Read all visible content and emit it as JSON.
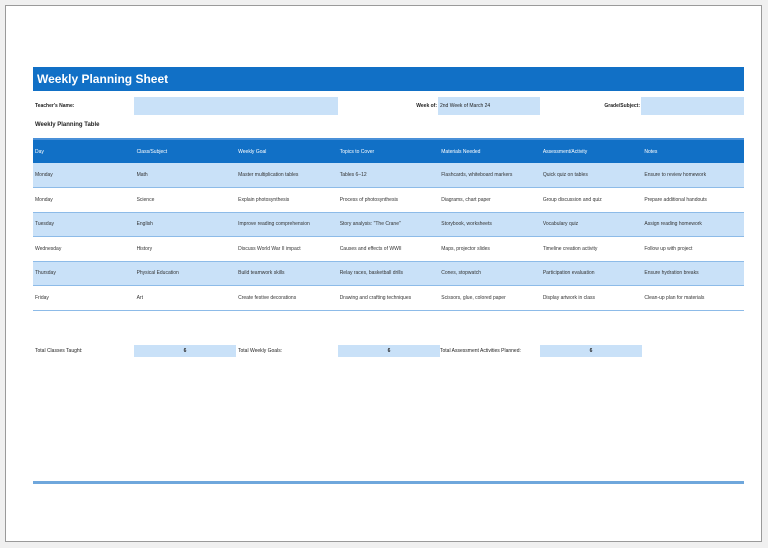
{
  "title": "Weekly Planning Sheet",
  "info": {
    "teacher_label": "Teacher's Name:",
    "teacher_value": "",
    "week_label": "Week of:",
    "week_value": "2nd Week of March 24",
    "grade_label": "Grade/Subject:",
    "grade_value": ""
  },
  "table_title": "Weekly Planning Table",
  "columns": [
    "Day",
    "Class/Subject",
    "Weekly Goal",
    "Topics to Cover",
    "Materials Needed",
    "Assessment/Activity",
    "Notes"
  ],
  "rows": [
    [
      "Monday",
      "Math",
      "Master multiplication tables",
      "Tables 6–12",
      "Flashcards, whiteboard markers",
      "Quick quiz on tables",
      "Ensure to review homework"
    ],
    [
      "Monday",
      "Science",
      "Explain photosynthesis",
      "Process of photosynthesis",
      "Diagrams, chart paper",
      "Group discussion and quiz",
      "Prepare additional handouts"
    ],
    [
      "Tuesday",
      "English",
      "Improve reading comprehension",
      "Story analysis: \"The Crane\"",
      "Storybook, worksheets",
      "Vocabulary quiz",
      "Assign reading homework"
    ],
    [
      "Wednesday",
      "History",
      "Discuss World War II impact",
      "Causes and effects of WWII",
      "Maps, projector slides",
      "Timeline creation activity",
      "Follow up with project"
    ],
    [
      "Thursday",
      "Physical Education",
      "Build teamwork skills",
      "Relay races, basketball drills",
      "Cones, stopwatch",
      "Participation evaluation",
      "Ensure hydration breaks"
    ],
    [
      "Friday",
      "Art",
      "Create festive decorations",
      "Drawing and crafting techniques",
      "Scissors, glue, colored paper",
      "Display artwork in class",
      "Clean-up plan for materials"
    ]
  ],
  "totals": {
    "classes_label": "Total Classes Taught:",
    "classes_value": "6",
    "goals_label": "Total Weekly Goals:",
    "goals_value": "6",
    "assess_label": "Total Assessment Activities Planned:",
    "assess_value": "6"
  },
  "colors": {
    "header": "#1170c6",
    "band": "#c9e1f8"
  }
}
